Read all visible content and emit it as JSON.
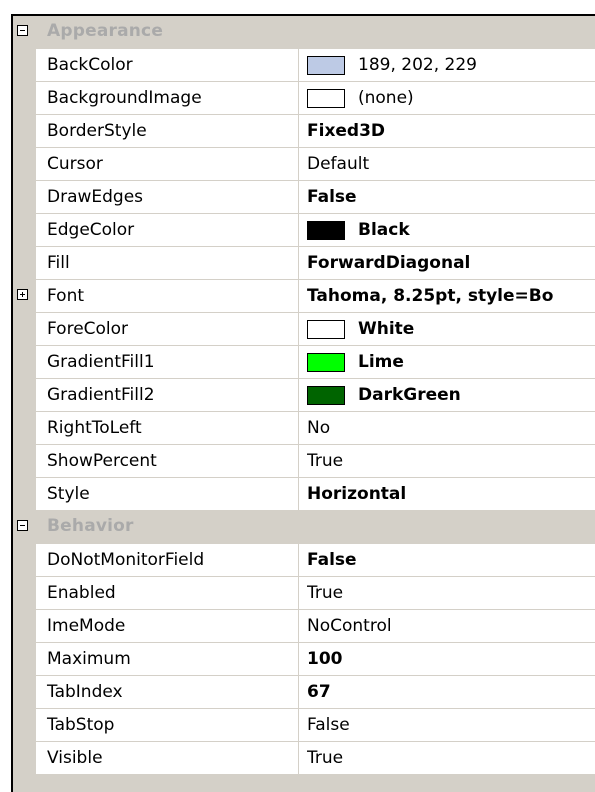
{
  "categories": [
    {
      "label": "Appearance",
      "expanded": true,
      "properties": [
        {
          "name": "BackColor",
          "value": "189, 202, 229",
          "bold": false,
          "swatch": "#bdcae5"
        },
        {
          "name": "BackgroundImage",
          "value": "(none)",
          "bold": false,
          "swatch": "#ffffff"
        },
        {
          "name": "BorderStyle",
          "value": "Fixed3D",
          "bold": true
        },
        {
          "name": "Cursor",
          "value": "Default",
          "bold": false
        },
        {
          "name": "DrawEdges",
          "value": "False",
          "bold": true
        },
        {
          "name": "EdgeColor",
          "value": "Black",
          "bold": true,
          "swatch": "#000000"
        },
        {
          "name": "Fill",
          "value": "ForwardDiagonal",
          "bold": true
        },
        {
          "name": "Font",
          "value": "Tahoma, 8.25pt, style=Bo",
          "bold": true,
          "expandable": true
        },
        {
          "name": "ForeColor",
          "value": "White",
          "bold": true,
          "swatch": "#ffffff"
        },
        {
          "name": "GradientFill1",
          "value": "Lime",
          "bold": true,
          "swatch": "#00ff00"
        },
        {
          "name": "GradientFill2",
          "value": "DarkGreen",
          "bold": true,
          "swatch": "#006400"
        },
        {
          "name": "RightToLeft",
          "value": "No",
          "bold": false
        },
        {
          "name": "ShowPercent",
          "value": "True",
          "bold": false
        },
        {
          "name": "Style",
          "value": "Horizontal",
          "bold": true
        }
      ]
    },
    {
      "label": "Behavior",
      "expanded": true,
      "properties": [
        {
          "name": "DoNotMonitorField",
          "value": "False",
          "bold": true
        },
        {
          "name": "Enabled",
          "value": "True",
          "bold": false
        },
        {
          "name": "ImeMode",
          "value": "NoControl",
          "bold": false
        },
        {
          "name": "Maximum",
          "value": "100",
          "bold": true
        },
        {
          "name": "TabIndex",
          "value": "67",
          "bold": true
        },
        {
          "name": "TabStop",
          "value": "False",
          "bold": false
        },
        {
          "name": "Visible",
          "value": "True",
          "bold": false
        }
      ]
    }
  ],
  "colors": {
    "category_bg": "#d4d0c8",
    "category_text": "#aaaaaa",
    "row_bg": "#ffffff",
    "gridline": "#d4d0c8"
  }
}
